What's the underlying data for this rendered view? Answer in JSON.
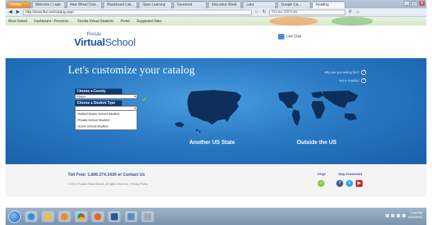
{
  "browser": {
    "tabs": [
      "Firefox",
      "Welcome | Login",
      "New Wheel Cuts...",
      "Blackboard Lab...",
      "Open Learning",
      "Facebook",
      "Education Week",
      "Labs",
      "Google Cal...",
      "Reading"
    ],
    "url": "http://www.flvs.net/catalog.aspx",
    "search_placeholder": "Florida VIRTUAL",
    "bookmarks": [
      "Most Visited",
      "Dashboard - Personal...",
      "Florida Virtual Students",
      "Portal",
      "Suggested Sites"
    ],
    "window_controls": [
      "_",
      "□",
      "✕"
    ]
  },
  "header": {
    "logo_top": "Florida",
    "logo_main": "Virtual",
    "logo_tail": "School",
    "live_chat": "Live Chat"
  },
  "hero": {
    "title": "Let's customize your catalog",
    "link_why": "Why are you asking this?",
    "link_not_florida": "Not in Florida?",
    "county_label": "Choose a County",
    "county_value": "Pasco",
    "student_type_label": "Choose a Student Type",
    "student_type_value": "",
    "student_type_options": [
      "Public/Charter School Student",
      "Private School Student",
      "Home School Student"
    ],
    "another_state": "Another US State",
    "outside_us": "Outside the US"
  },
  "footer": {
    "toll_free_label": "Toll Free:",
    "toll_free_number": "1.800.374.1430",
    "or_text": "or",
    "contact_us": "Contact Us",
    "copyright": "© 2012 Florida Virtual School. All rights reserved.  |  Privacy Policy",
    "faqs": "FAQs",
    "stay_connected": "Stay Connected"
  },
  "taskbar": {
    "time": "3:46 PM",
    "date": "8/23/2012"
  },
  "colors": {
    "hero_blue": "#2a7ac4",
    "brand_navy": "#1f4d9a",
    "check_green": "#6dcc3b"
  }
}
